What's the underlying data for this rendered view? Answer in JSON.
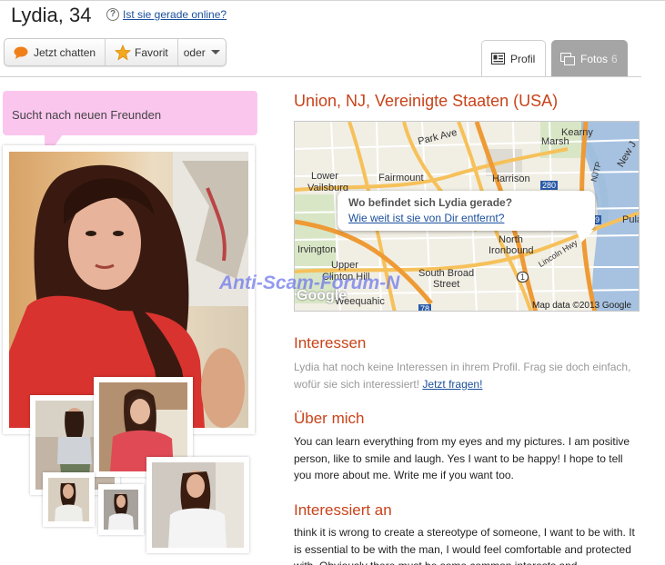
{
  "profile": {
    "name_age": "Lydia, 34",
    "online_link": "Ist sie gerade online?",
    "looking_for": "Sucht nach neuen Freunden",
    "location": "Union, NJ, Vereinigte Staaten (USA)"
  },
  "actions": {
    "chat": "Jetzt chatten",
    "favorite": "Favorit",
    "more": "oder"
  },
  "tabs": {
    "profile": "Profil",
    "photos": "Fotos",
    "photos_count": "6"
  },
  "map": {
    "popup_question": "Wo befindet sich Lydia gerade?",
    "popup_link": "Wie weit ist sie von Dir entfernt?",
    "attribution": "Map data ©2013 Google",
    "logo": "Google",
    "places": [
      "Park Ave",
      "Kearny",
      "Marsh",
      "Lower",
      "Vailsburg",
      "Fairmount",
      "Harrison",
      "Irvington",
      "North",
      "Ironbound",
      "Upper",
      "Clinton Hill",
      "South Broad",
      "Street",
      "Weequahic",
      "Lincoln Hwy",
      "NJTP",
      "Pula",
      "New J"
    ],
    "shields": [
      "280",
      "1",
      "78",
      "9"
    ]
  },
  "watermark": "Anti-Scam-Forum-N",
  "sections": {
    "interests_title": "Interessen",
    "interests_text": "Lydia hat noch keine Interessen in ihrem Profil. Frag sie doch einfach, wofür sie sich interessiert!",
    "interests_link": "Jetzt fragen!",
    "about_title": "Über mich",
    "about_text": "You can learn everything from my eyes and my pictures. I am positive person, like to smile and laugh. Yes I want to be happy! I hope to tell you more about me. Write me if you want too.",
    "seeking_title": "Interessiert an",
    "seeking_text": "think it is wrong to create a stereotype of someone, I want to be with. It is essential to be with the man, I would feel comfortable and protected with. Obviously there must be some common interests and"
  },
  "colors": {
    "accent": "#c8431a",
    "link": "#1a4f9c",
    "bubble": "#fbc6ee"
  }
}
